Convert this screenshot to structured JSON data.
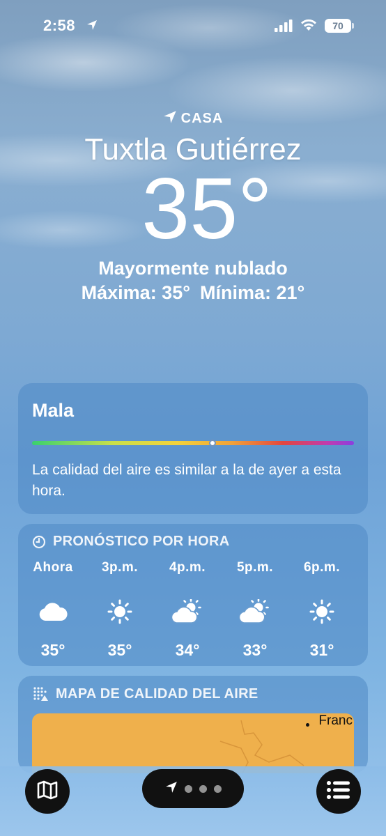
{
  "status_bar": {
    "time": "2:58",
    "battery": "70"
  },
  "header": {
    "home_label": "CASA",
    "city": "Tuxtla Gutiérrez",
    "temperature": "35°",
    "condition": "Mayormente nublado",
    "high": "Máxima: 35°",
    "low": "Mínima: 21°"
  },
  "air_quality": {
    "level": "Mala",
    "scale_position": 0.56,
    "description": "La calidad del aire es similar a la de ayer a esta hora."
  },
  "hourly": {
    "title": "PRONÓSTICO POR HORA",
    "hours": [
      {
        "label": "Ahora",
        "icon": "cloud-icon",
        "temp": "35°"
      },
      {
        "label": "3p.m.",
        "icon": "sun-icon",
        "temp": "35°"
      },
      {
        "label": "4p.m.",
        "icon": "partly-sunny-icon",
        "temp": "34°"
      },
      {
        "label": "5p.m.",
        "icon": "partly-sunny-icon",
        "temp": "33°"
      },
      {
        "label": "6p.m.",
        "icon": "sun-icon",
        "temp": "31°"
      }
    ]
  },
  "air_map": {
    "title": "MAPA DE CALIDAD DEL AIRE",
    "place_label": "Franc"
  },
  "colors": {
    "map_fill": "#efb04c",
    "card_bg": "rgba(78,136,196,0.55)"
  }
}
